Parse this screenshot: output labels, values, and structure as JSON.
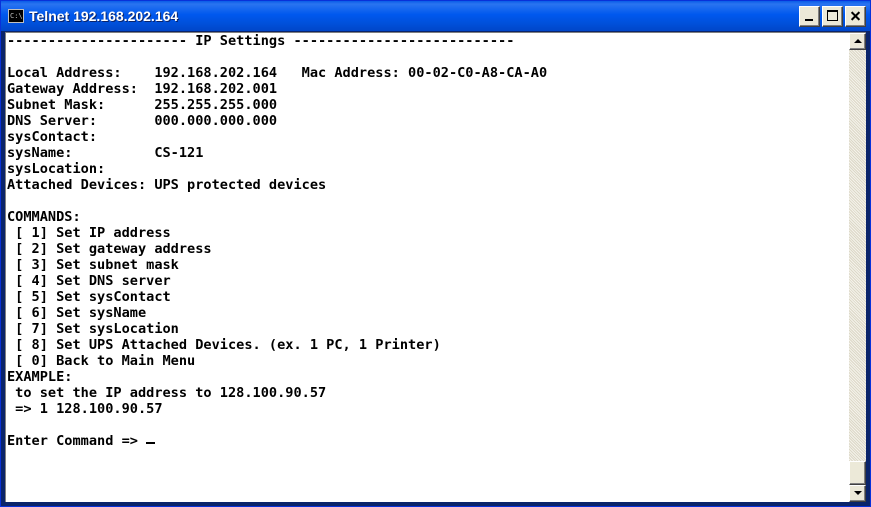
{
  "window": {
    "title": "Telnet 192.168.202.164",
    "icon": "console-icon",
    "icon_text": "C:\\"
  },
  "colors": {
    "titlebar": "#0058ee",
    "terminal_bg": "#ffffff",
    "terminal_text": "#000000"
  },
  "terminal": {
    "lines": [
      "---------------------- IP Settings ---------------------------",
      "",
      "Local Address:    192.168.202.164   Mac Address: 00-02-C0-A8-CA-A0",
      "Gateway Address:  192.168.202.001",
      "Subnet Mask:      255.255.255.000",
      "DNS Server:       000.000.000.000",
      "sysContact:",
      "sysName:          CS-121",
      "sysLocation:",
      "Attached Devices: UPS protected devices",
      "",
      "COMMANDS:",
      " [ 1] Set IP address",
      " [ 2] Set gateway address",
      " [ 3] Set subnet mask",
      " [ 4] Set DNS server",
      " [ 5] Set sysContact",
      " [ 6] Set sysName",
      " [ 7] Set sysLocation",
      " [ 8] Set UPS Attached Devices. (ex. 1 PC, 1 Printer)",
      " [ 0] Back to Main Menu",
      "EXAMPLE:",
      " to set the IP address to 128.100.90.57",
      " => 1 128.100.90.57",
      ""
    ],
    "prompt": "Enter Command => "
  }
}
